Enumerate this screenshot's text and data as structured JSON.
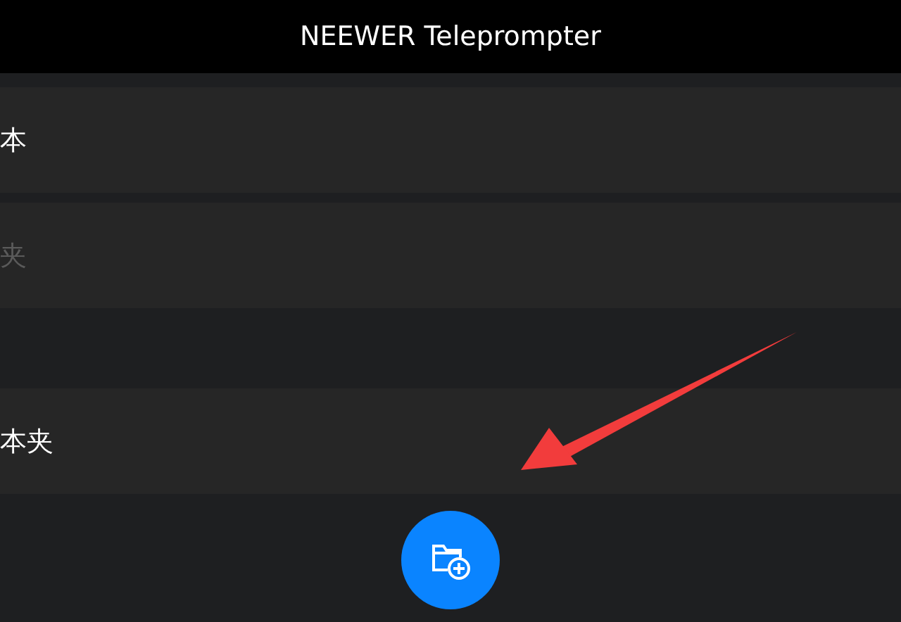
{
  "header": {
    "title": "NEEWER Teleprompter"
  },
  "rows": [
    {
      "kind": "item",
      "label": "本"
    },
    {
      "kind": "input",
      "placeholder": "夹"
    },
    {
      "kind": "spacer"
    },
    {
      "kind": "item",
      "label": "本夹"
    }
  ]
}
